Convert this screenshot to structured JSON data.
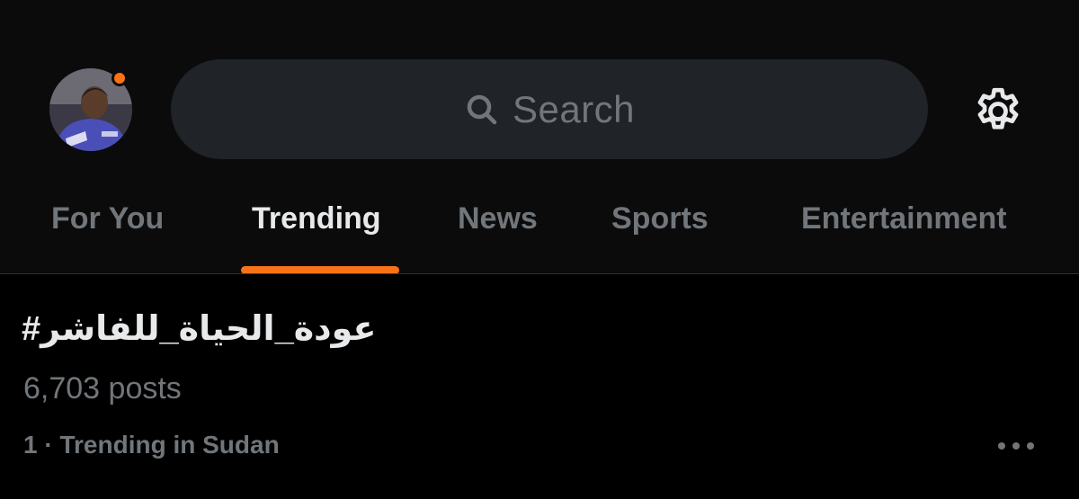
{
  "header": {
    "search": {
      "placeholder": "Search",
      "icon": "search-icon"
    },
    "avatar": {
      "notification_dot_color": "#f97316"
    },
    "settings_icon": "gear-icon"
  },
  "tabs": [
    {
      "label": "For You",
      "active": false
    },
    {
      "label": "Trending",
      "active": true
    },
    {
      "label": "News",
      "active": false
    },
    {
      "label": "Sports",
      "active": false
    },
    {
      "label": "Entertainment",
      "active": false
    }
  ],
  "trend": {
    "title": "#عودة_الحياة_للفاشر",
    "posts": "6,703 posts",
    "meta": "1 · Trending in Sudan",
    "more_icon": "more-horizontal-icon"
  },
  "colors": {
    "accent": "#f97316",
    "background": "#000000",
    "header_background": "#0b0b0c",
    "search_background": "#202327",
    "primary_text": "#e7e9ea",
    "secondary_text": "#71767b"
  }
}
